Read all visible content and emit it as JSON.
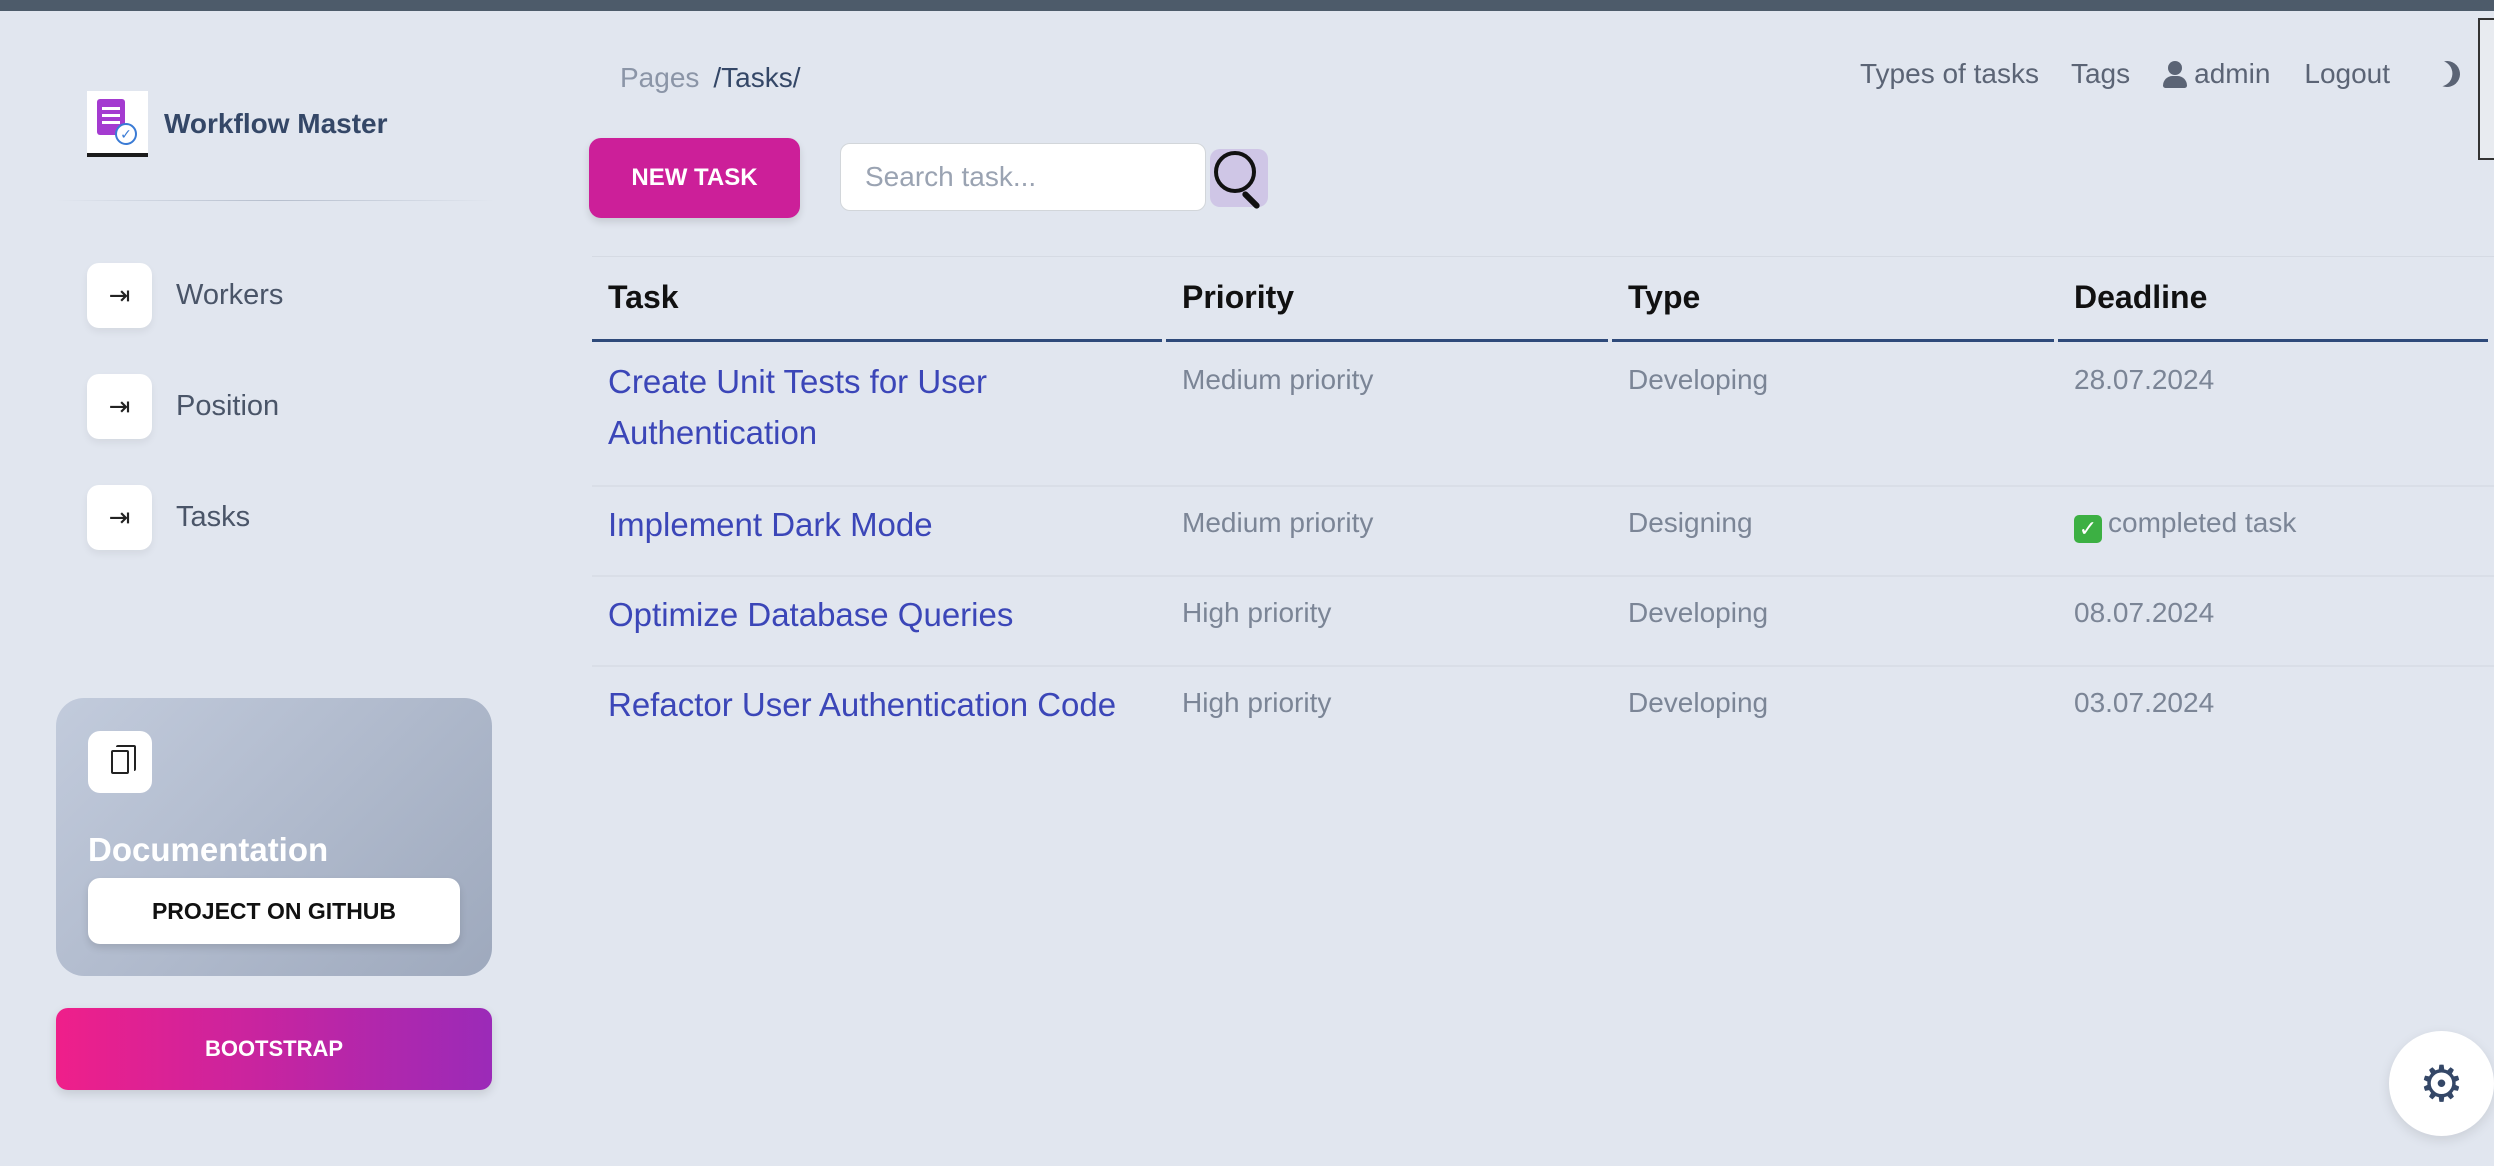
{
  "app": {
    "name": "Workflow Master"
  },
  "breadcrumb": {
    "root": "Pages",
    "current": "/Tasks/"
  },
  "topnav": {
    "types": "Types of tasks",
    "tags": "Tags",
    "user": "admin",
    "logout": "Logout"
  },
  "sidebar": {
    "items": [
      {
        "label": "Workers",
        "icon": "arrow-right-to-bar-icon"
      },
      {
        "label": "Position",
        "icon": "arrow-right-to-bar-icon"
      },
      {
        "label": "Tasks",
        "icon": "arrow-right-to-bar-icon"
      }
    ],
    "doc_card": {
      "title": "Documentation",
      "button": "PROJECT ON GITHUB"
    },
    "bootstrap_button": "BOOTSTRAP"
  },
  "toolbar": {
    "new_task": "NEW TASK",
    "search_placeholder": "Search task..."
  },
  "table": {
    "headers": [
      "Task",
      "Priority",
      "Type",
      "Deadline"
    ],
    "rows": [
      {
        "task": "Create Unit Tests for User Authentication",
        "priority": "Medium priority",
        "type": "Developing",
        "deadline": "28.07.2024",
        "completed": false
      },
      {
        "task": "Implement Dark Mode",
        "priority": "Medium priority",
        "type": "Designing",
        "deadline": "completed task",
        "completed": true
      },
      {
        "task": "Optimize Database Queries",
        "priority": "High priority",
        "type": "Developing",
        "deadline": "08.07.2024",
        "completed": false
      },
      {
        "task": "Refactor User Authentication Code",
        "priority": "High priority",
        "type": "Developing",
        "deadline": "03.07.2024",
        "completed": false
      }
    ]
  },
  "colors": {
    "accent": "#cc1f99",
    "link": "#3b46b8",
    "background": "#e1e6ef"
  }
}
